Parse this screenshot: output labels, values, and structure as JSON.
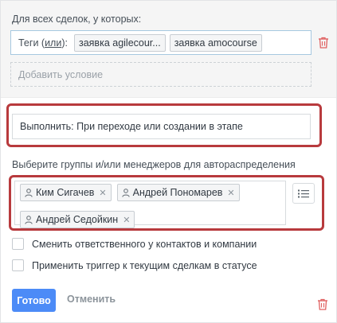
{
  "condition": {
    "title": "Для всех сделок, у которых:",
    "tags_label_prefix": "Теги (",
    "tags_label_or": "или",
    "tags_label_suffix": "):",
    "tags": [
      "заявка agilecour...",
      "заявка amocourse"
    ],
    "add_condition_placeholder": "Добавить условие"
  },
  "execute": {
    "value": "Выполнить: При переходе или создании в этапе"
  },
  "assign": {
    "label": "Выберите группы и/или менеджеров для автораспределения",
    "managers": [
      "Ким Сигачев",
      "Андрей Пономарев",
      "Андрей Седойкин"
    ]
  },
  "checkboxes": [
    {
      "label": "Сменить ответственного у контактов и компании",
      "checked": false
    },
    {
      "label": "Применить триггер к текущим сделкам в статусе",
      "checked": false
    }
  ],
  "actions": {
    "done_label": "Готово",
    "cancel_label": "Отменить"
  },
  "colors": {
    "accent": "#4c8bf7",
    "highlight": "#b83a3d",
    "trash": "#e06060"
  }
}
